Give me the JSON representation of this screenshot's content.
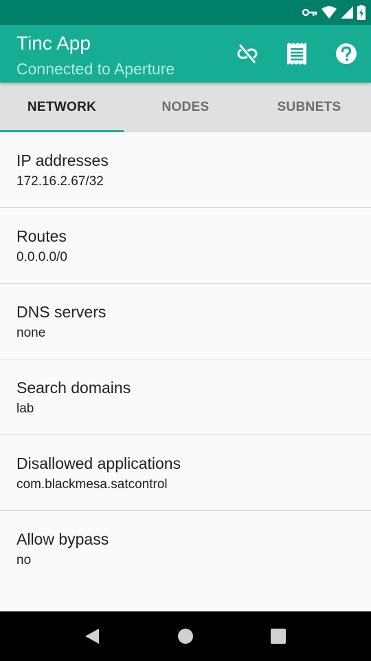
{
  "colors": {
    "status_bar": "#00806b",
    "app_bar": "#16ad94",
    "subtitle": "#b4ece0",
    "tab_bar": "#e0e0e0",
    "tab_indicator": "#16ad94",
    "background": "#fafafa"
  },
  "status_bar": {
    "icons": [
      "vpn-key-icon",
      "wifi-icon",
      "cell-signal-icon",
      "battery-charging-icon"
    ]
  },
  "app_bar": {
    "title": "Tinc App",
    "subtitle": "Connected to Aperture",
    "actions": [
      "link-off-icon",
      "log-icon",
      "help-icon"
    ]
  },
  "tabs": [
    {
      "label": "NETWORK",
      "active": true
    },
    {
      "label": "NODES",
      "active": false
    },
    {
      "label": "SUBNETS",
      "active": false
    }
  ],
  "network_info": [
    {
      "label": "IP addresses",
      "value": "172.16.2.67/32"
    },
    {
      "label": "Routes",
      "value": "0.0.0.0/0"
    },
    {
      "label": "DNS servers",
      "value": "none"
    },
    {
      "label": "Search domains",
      "value": "lab"
    },
    {
      "label": "Disallowed applications",
      "value": "com.blackmesa.satcontrol"
    },
    {
      "label": "Allow bypass",
      "value": "no"
    }
  ],
  "nav_bar": {
    "buttons": [
      "back-icon",
      "home-icon",
      "recents-icon"
    ]
  }
}
